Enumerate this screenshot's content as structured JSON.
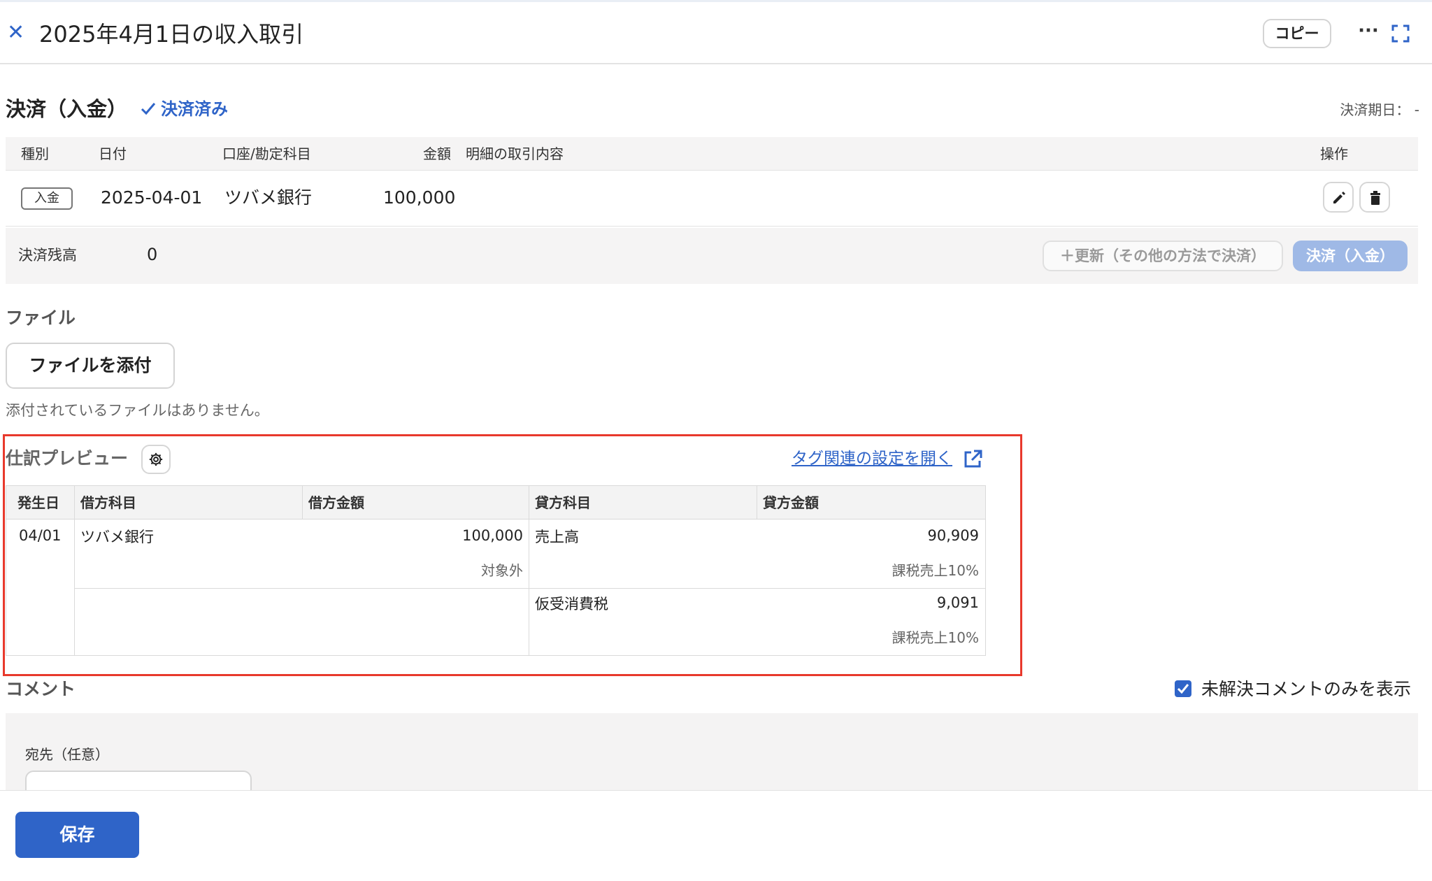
{
  "header": {
    "title": "2025年4月1日の収入取引",
    "copy_label": "コピー",
    "more_label": "···"
  },
  "settlement": {
    "title": "決済（入金）",
    "status": "決済済み",
    "due_date_label": "決済期日：",
    "due_date_value": "-",
    "columns": [
      "種別",
      "日付",
      "口座/勘定科目",
      "金額",
      "明細の取引内容",
      "操作"
    ],
    "row": {
      "kind": "入金",
      "date": "2025-04-01",
      "account": "ツバメ銀行",
      "amount": "100,000",
      "detail": ""
    },
    "balance_label": "決済残高",
    "balance_value": "0",
    "update_label": "＋更新（その他の方法で決済）",
    "settle_label": "決済（入金）"
  },
  "files": {
    "title": "ファイル",
    "attach_label": "ファイルを添付",
    "empty_text": "添付されているファイルはありません。"
  },
  "journal": {
    "title": "仕訳プレビュー",
    "tag_link": "タグ関連の設定を開く",
    "columns": [
      "発生日",
      "借方科目",
      "借方金額",
      "貸方科目",
      "貸方金額"
    ],
    "date": "04/01",
    "rows": [
      {
        "debit_account": "ツバメ銀行",
        "debit_amount": "100,000",
        "debit_tax": "対象外",
        "credit_account": "売上高",
        "credit_amount": "90,909",
        "credit_tax": "課税売上10%"
      },
      {
        "debit_account": "",
        "debit_amount": "",
        "debit_tax": "",
        "credit_account": "仮受消費税",
        "credit_amount": "9,091",
        "credit_tax": "課税売上10%"
      }
    ]
  },
  "comments": {
    "title": "コメント",
    "unresolved_only_label": "未解決コメントのみを表示",
    "unresolved_only_checked": true,
    "to_label": "宛先（任意）",
    "to_value": ""
  },
  "footer": {
    "save_label": "保存"
  },
  "colors": {
    "accent": "#2f64c8",
    "highlight_border": "#e8392c",
    "disabled_button": "#9fb9e6"
  }
}
